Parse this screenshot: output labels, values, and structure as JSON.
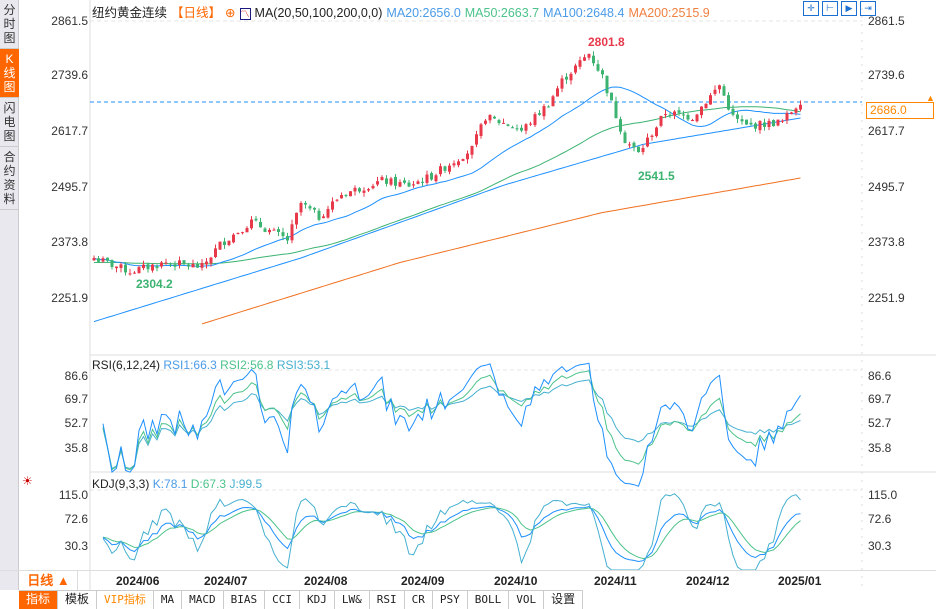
{
  "sidebar": {
    "tabs": [
      {
        "label": "分时图"
      },
      {
        "label": "K线图",
        "active": true
      },
      {
        "label": "闪电图"
      },
      {
        "label": "合约资料"
      }
    ]
  },
  "header": {
    "title": "纽约黄金连续",
    "period": "【日线】",
    "ma_label": "MA(20,50,100,200,0,0)",
    "ma20": "MA20:2656.0",
    "ma50": "MA50:2663.7",
    "ma100": "MA100:2648.4",
    "ma200": "MA200:2515.9"
  },
  "colors": {
    "up": "#e8394b",
    "down": "#3cb371",
    "ma20": "#1e90ff",
    "ma50": "#3cb371",
    "ma100": "#1e90ff",
    "ma200": "#f07020",
    "accent": "#ff6600"
  },
  "price_axis": {
    "ticks": [
      "2861.5",
      "2739.6",
      "2617.7",
      "2495.7",
      "2373.8",
      "2251.9"
    ],
    "current": "2686.0"
  },
  "annotations": {
    "high": "2801.8",
    "low1": "2304.2",
    "low2": "2541.5"
  },
  "rsi": {
    "label": "RSI(6,12,24)",
    "rsi1": "RSI1:66.3",
    "rsi2": "RSI2:56.8",
    "rsi3": "RSI3:53.1",
    "ticks": [
      "86.6",
      "69.7",
      "52.7",
      "35.8"
    ]
  },
  "kdj": {
    "label": "KDJ(9,3,3)",
    "k": "K:78.1",
    "d": "D:67.3",
    "j": "J:99.5",
    "ticks": [
      "115.0",
      "72.6",
      "30.3"
    ]
  },
  "dates": [
    "2024/06",
    "2024/07",
    "2024/08",
    "2024/09",
    "2024/10",
    "2024/11",
    "2024/12",
    "2025/01"
  ],
  "period_button": "日线 ▲",
  "toolbar": [
    "指标",
    "模板",
    "VIP指标",
    "MA",
    "MACD",
    "BIAS",
    "CCI",
    "KDJ",
    "LW&",
    "RSI",
    "CR",
    "PSY",
    "BOLL",
    "VOL",
    "设置"
  ],
  "chart_data": {
    "type": "candlestick",
    "ylim": [
      2251.9,
      2861.5
    ],
    "close_keypoints": [
      [
        0,
        2340
      ],
      [
        8,
        2310
      ],
      [
        16,
        2330
      ],
      [
        24,
        2320
      ],
      [
        28,
        2370
      ],
      [
        35,
        2420
      ],
      [
        39,
        2400
      ],
      [
        43,
        2380
      ],
      [
        46,
        2460
      ],
      [
        50,
        2430
      ],
      [
        55,
        2480
      ],
      [
        64,
        2510
      ],
      [
        70,
        2500
      ],
      [
        75,
        2520
      ],
      [
        84,
        2580
      ],
      [
        87,
        2650
      ],
      [
        93,
        2630
      ],
      [
        95,
        2620
      ],
      [
        101,
        2680
      ],
      [
        104,
        2730
      ],
      [
        110,
        2790
      ],
      [
        113,
        2740
      ],
      [
        115,
        2680
      ],
      [
        118,
        2600
      ],
      [
        121,
        2570
      ],
      [
        127,
        2660
      ],
      [
        133,
        2650
      ],
      [
        139,
        2720
      ],
      [
        142,
        2650
      ],
      [
        145,
        2630
      ],
      [
        153,
        2640
      ],
      [
        157,
        2686
      ]
    ],
    "ma100_keypoints": [
      [
        0,
        2200
      ],
      [
        46,
        2340
      ],
      [
        91,
        2500
      ],
      [
        122,
        2590
      ],
      [
        157,
        2648
      ]
    ],
    "ma200_keypoints": [
      [
        24,
        2195
      ],
      [
        68,
        2330
      ],
      [
        113,
        2440
      ],
      [
        157,
        2516
      ]
    ]
  }
}
